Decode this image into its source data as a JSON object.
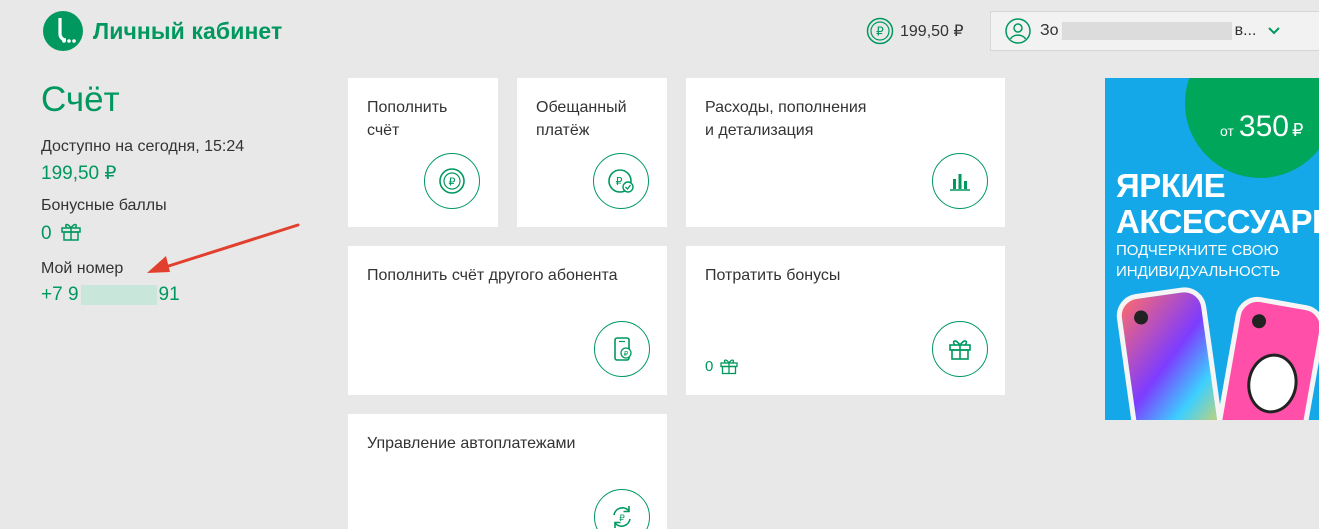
{
  "header": {
    "logo_text": "Личный кабинет",
    "balance": "199,50 ₽",
    "user_name_prefix": "Зо",
    "user_name_suffix": "в..."
  },
  "account": {
    "title": "Счёт",
    "available_label": "Доступно на сегодня, 15:24",
    "available_value": "199,50 ₽",
    "bonus_label": "Бонусные баллы",
    "bonus_value": "0",
    "number_label": "Мой номер",
    "number_prefix": "+7 9",
    "number_suffix": "91"
  },
  "tiles": {
    "topup": "Пополнить\nсчёт",
    "promised": "Обещанный\nплатёж",
    "expenses": "Расходы, пополнения\nи детализация",
    "topup_other": "Пополнить счёт другого абонента",
    "spend_bonus": "Потратить бонусы",
    "spend_bonus_value": "0",
    "autopay": "Управление автоплатежами"
  },
  "banner": {
    "from": "от",
    "amount": "350",
    "currency": "₽",
    "headline_1": "ЯРКИЕ",
    "headline_2": "АКСЕССУАРЫ",
    "sub_1": "ПОДЧЕРКНИТЕ СВОЮ",
    "sub_2": "ИНДИВИДУАЛЬНОСТЬ"
  },
  "colors": {
    "brand_green": "#00985f",
    "background": "#e8e8e8",
    "banner_blue": "#14a8e8",
    "arrow_red": "#e2402e"
  }
}
